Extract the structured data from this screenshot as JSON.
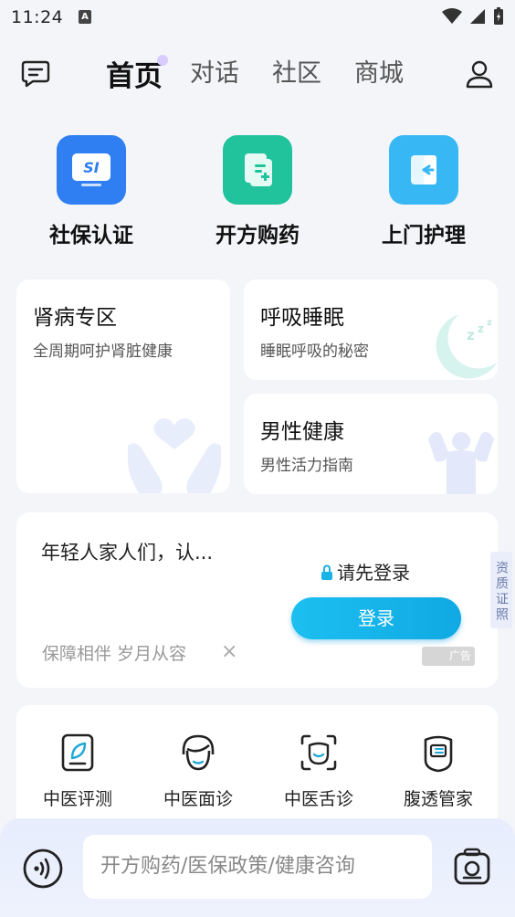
{
  "status_bar": {
    "time": "11:24",
    "app_badge": "A"
  },
  "header": {
    "tabs": [
      {
        "label": "首页",
        "active": true
      },
      {
        "label": "对话",
        "active": false
      },
      {
        "label": "社区",
        "active": false
      },
      {
        "label": "商城",
        "active": false
      }
    ]
  },
  "quick_services": [
    {
      "label": "社保认证",
      "icon": "social-security-icon",
      "color": "#2f7ff3",
      "icon_text": "SI"
    },
    {
      "label": "开方购药",
      "icon": "prescription-icon",
      "color": "#20c39c"
    },
    {
      "label": "上门护理",
      "icon": "home-care-icon",
      "color": "#37b8f4"
    }
  ],
  "cards": {
    "kidney": {
      "title": "肾病专区",
      "subtitle": "全周期呵护肾脏健康"
    },
    "sleep": {
      "title": "呼吸睡眠",
      "subtitle": "睡眠呼吸的秘密"
    },
    "male": {
      "title": "男性健康",
      "subtitle": "男性活力指南"
    }
  },
  "promo": {
    "headline": "年轻人家人们，认...",
    "tagline": "保障相伴 岁月从容",
    "close": "×",
    "login_hint": "请先登录",
    "login_button": "登录",
    "ad_label": "广告"
  },
  "qualification_label": "资质证照",
  "tcm_services": [
    {
      "label": "中医评测",
      "icon": "tcm-assessment-icon"
    },
    {
      "label": "中医面诊",
      "icon": "face-diagnosis-icon"
    },
    {
      "label": "中医舌诊",
      "icon": "tongue-diagnosis-icon"
    },
    {
      "label": "腹透管家",
      "icon": "dialysis-manager-icon"
    }
  ],
  "bottom_bar": {
    "placeholder": "开方购药/医保政策/健康咨询"
  }
}
